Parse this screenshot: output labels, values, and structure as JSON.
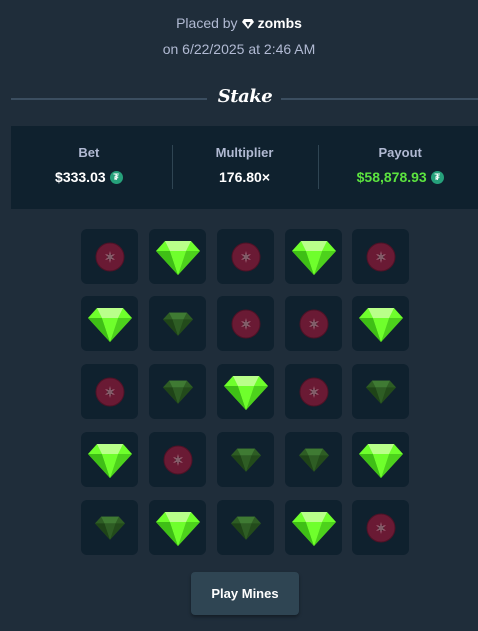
{
  "header": {
    "placed_prefix": "Placed by",
    "username": "zombs",
    "date_line": "on 6/22/2025 at 2:46 AM",
    "brand": "Stake"
  },
  "stats": {
    "bet_label": "Bet",
    "bet_value": "$333.03",
    "multiplier_label": "Multiplier",
    "multiplier_value": "176.80×",
    "payout_label": "Payout",
    "payout_value": "$58,878.93",
    "currency_icon": "tether-icon"
  },
  "grid": {
    "rows": 5,
    "cols": 5,
    "tiles": [
      [
        "mine",
        "gem-revealed",
        "mine",
        "gem-revealed",
        "mine"
      ],
      [
        "gem-revealed",
        "gem-hidden",
        "mine",
        "mine",
        "gem-revealed"
      ],
      [
        "mine",
        "gem-hidden",
        "gem-revealed",
        "mine",
        "gem-hidden"
      ],
      [
        "gem-revealed",
        "mine",
        "gem-hidden",
        "gem-hidden",
        "gem-revealed"
      ],
      [
        "gem-hidden",
        "gem-revealed",
        "gem-hidden",
        "gem-revealed",
        "mine"
      ]
    ]
  },
  "colors": {
    "background": "#1f2d3a",
    "panel": "#0f212e",
    "gem_bright": "#6fff2c",
    "gem_dim": "#2e5d24",
    "mine": "#6a1a34",
    "payout_green": "#5ce33f"
  },
  "play_button": {
    "label": "Play Mines"
  }
}
